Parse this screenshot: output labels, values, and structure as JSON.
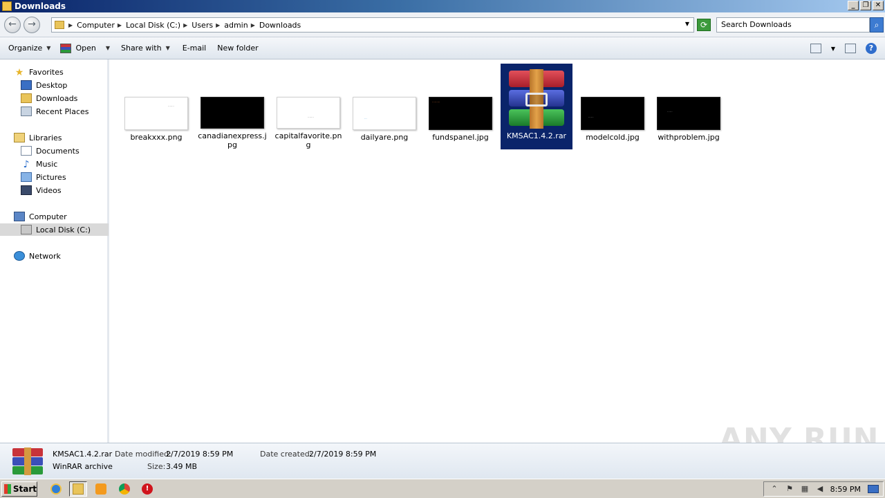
{
  "window": {
    "title": "Downloads"
  },
  "address": {
    "crumbs": [
      "Computer",
      "Local Disk (C:)",
      "Users",
      "admin",
      "Downloads"
    ],
    "search_placeholder": "Search Downloads"
  },
  "toolbar": {
    "organize": "Organize",
    "open": "Open",
    "share_with": "Share with",
    "email": "E-mail",
    "new_folder": "New folder"
  },
  "nav": {
    "favorites": "Favorites",
    "desktop": "Desktop",
    "downloads": "Downloads",
    "recent_places": "Recent Places",
    "libraries": "Libraries",
    "documents": "Documents",
    "music": "Music",
    "pictures": "Pictures",
    "videos": "Videos",
    "computer": "Computer",
    "local_disk": "Local Disk (C:)",
    "network": "Network"
  },
  "files": [
    {
      "name": "breakxxx.png",
      "thumb": "white"
    },
    {
      "name": "canadianexpress.jpg",
      "thumb": "black"
    },
    {
      "name": "capitalfavorite.png",
      "thumb": "white"
    },
    {
      "name": "dailyare.png",
      "thumb": "white"
    },
    {
      "name": "fundspanel.jpg",
      "thumb": "black"
    },
    {
      "name": "KMSAC1.4.2.rar",
      "thumb": "rar",
      "selected": true
    },
    {
      "name": "modelcold.jpg",
      "thumb": "black"
    },
    {
      "name": "withproblem.jpg",
      "thumb": "black"
    }
  ],
  "details": {
    "name": "KMSAC1.4.2.rar",
    "type": "WinRAR archive",
    "modified_label": "Date modified:",
    "modified_value": "2/7/2019 8:59 PM",
    "created_label": "Date created:",
    "created_value": "2/7/2019 8:59 PM",
    "size_label": "Size:",
    "size_value": "3.49 MB"
  },
  "watermark": "ANY RUN",
  "taskbar": {
    "start": "Start",
    "clock": "8:59 PM"
  },
  "colors": {
    "selection": "#0a246a",
    "title_start": "#0a246a",
    "title_end": "#a6caf0"
  }
}
